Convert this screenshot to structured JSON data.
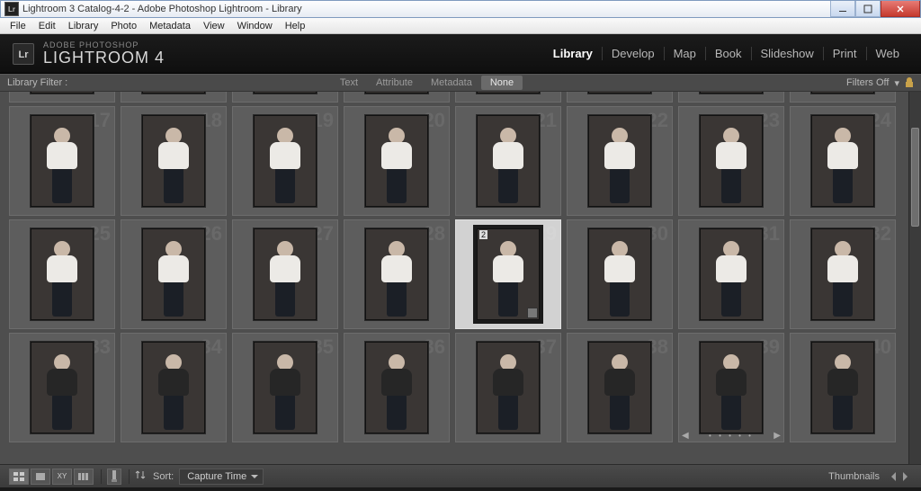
{
  "window": {
    "title": "Lightroom 3 Catalog-4-2 - Adobe Photoshop Lightroom - Library",
    "logo_text": "Lr"
  },
  "os_menu": [
    "File",
    "Edit",
    "Library",
    "Photo",
    "Metadata",
    "View",
    "Window",
    "Help"
  ],
  "identity": {
    "brand": "ADOBE PHOTOSHOP",
    "product": "LIGHTROOM 4",
    "logo": "Lr"
  },
  "modules": [
    {
      "label": "Library",
      "active": true
    },
    {
      "label": "Develop",
      "active": false
    },
    {
      "label": "Map",
      "active": false
    },
    {
      "label": "Book",
      "active": false
    },
    {
      "label": "Slideshow",
      "active": false
    },
    {
      "label": "Print",
      "active": false
    },
    {
      "label": "Web",
      "active": false
    }
  ],
  "filter": {
    "label": "Library Filter :",
    "tabs": [
      {
        "label": "Text",
        "selected": false
      },
      {
        "label": "Attribute",
        "selected": false
      },
      {
        "label": "Metadata",
        "selected": false
      },
      {
        "label": "None",
        "selected": true
      }
    ],
    "preset": "Filters Off"
  },
  "grid": {
    "start_index": 9,
    "selected_index": 29,
    "selected_stack_count": "2",
    "hover_index": 39,
    "columns": 8,
    "rows_visible": 4,
    "row3_outfit": "tank"
  },
  "toolbar": {
    "view_buttons": [
      "grid",
      "loupe",
      "compare",
      "survey"
    ],
    "active_view": "grid",
    "painter_label": "",
    "sort_label": "Sort:",
    "sort_value": "Capture Time",
    "thumb_label": "Thumbnails"
  }
}
